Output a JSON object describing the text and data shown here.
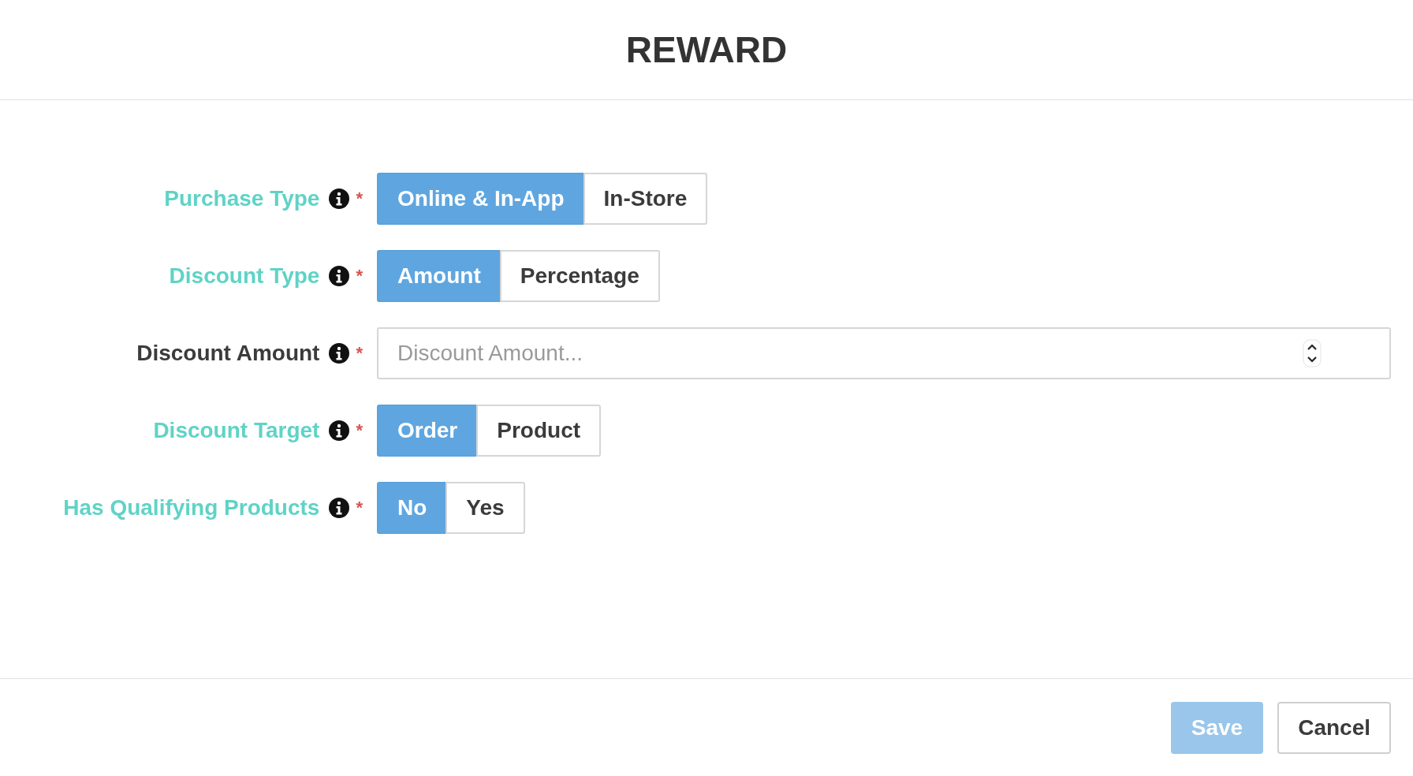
{
  "title": "REWARD",
  "fields": [
    {
      "kind": "toggle",
      "label": "Purchase Type",
      "required_mark": "*",
      "options": [
        {
          "label": "Online & In-App",
          "selected": true
        },
        {
          "label": "In-Store",
          "selected": false
        }
      ]
    },
    {
      "kind": "toggle",
      "label": "Discount Type",
      "required_mark": "*",
      "options": [
        {
          "label": "Amount",
          "selected": true
        },
        {
          "label": "Percentage",
          "selected": false
        }
      ]
    },
    {
      "kind": "number",
      "label": "Discount Amount",
      "required_mark": "*",
      "placeholder": "Discount Amount..."
    },
    {
      "kind": "toggle",
      "label": "Discount Target",
      "required_mark": "*",
      "options": [
        {
          "label": "Order",
          "selected": true
        },
        {
          "label": "Product",
          "selected": false
        }
      ]
    },
    {
      "kind": "toggle",
      "label": "Has Qualifying Products",
      "required_mark": "*",
      "options": [
        {
          "label": "No",
          "selected": true
        },
        {
          "label": "Yes",
          "selected": false
        }
      ]
    }
  ],
  "buttons": [
    {
      "kind": "primary",
      "label": "Save",
      "disabled": true
    },
    {
      "kind": "secondary",
      "label": "Cancel",
      "disabled": false
    }
  ]
}
